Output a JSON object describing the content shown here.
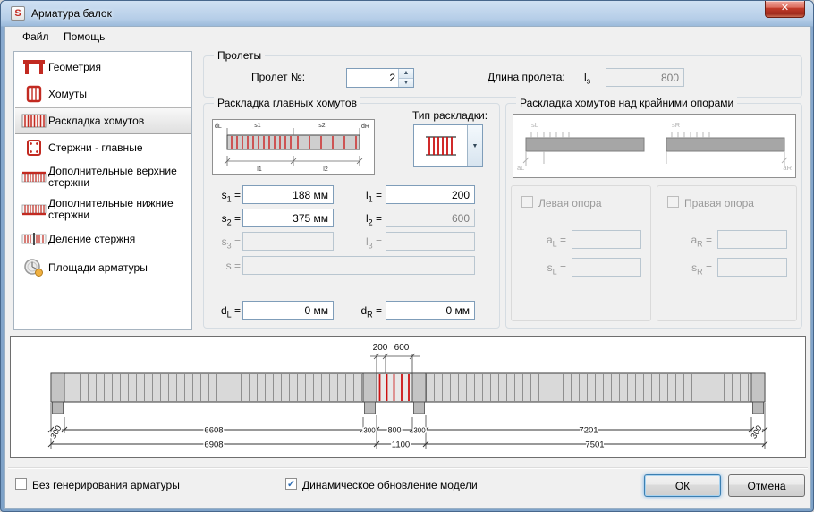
{
  "ui": {
    "equals": "=",
    "spin_up": "▲",
    "spin_down": "▼",
    "dropdown_arrow": "▼",
    "check_glyph": "✓"
  },
  "window": {
    "title": "Арматура балок",
    "app_initial": "S",
    "close_glyph": "✕"
  },
  "menu": {
    "items": [
      "Файл",
      "Помощь"
    ]
  },
  "sidebar": {
    "items": [
      "Геометрия",
      "Хомуты",
      "Раскладка хомутов",
      "Стержни - главные",
      "Дополнительные верхние стержни",
      "Дополнительные нижние стержни",
      "Деление стержня",
      "Площади арматуры"
    ]
  },
  "spans": {
    "title": "Пролеты",
    "span_no_label": "Пролет №:",
    "span_no_value": "2",
    "length_label": "Длина пролета:",
    "length_sym": "l",
    "length_sub": "s",
    "length_value": "800"
  },
  "layout_group": {
    "title": "Раскладка главных хомутов",
    "type_label": "Тип раскладки:",
    "mini_labels": {
      "dl": "dL",
      "s1": "s1",
      "s2": "s2",
      "dr": "dR",
      "l1": "l1",
      "l2": "l2"
    },
    "rows": [
      {
        "s_sym": "s",
        "s_sub": "1",
        "s_val": "188 мм",
        "l_sym": "l",
        "l_sub": "1",
        "l_val": "200"
      },
      {
        "s_sym": "s",
        "s_sub": "2",
        "s_val": "375 мм",
        "l_sym": "l",
        "l_sub": "2",
        "l_val": "600"
      },
      {
        "s_sym": "s",
        "s_sub": "3",
        "s_val": "",
        "l_sym": "l",
        "l_sub": "3",
        "l_val": ""
      }
    ],
    "s_row": {
      "sym": "s",
      "val": ""
    },
    "d_row": {
      "l_sym": "d",
      "l_sub": "L",
      "l_val": "0 мм",
      "r_sym": "d",
      "r_sub": "R",
      "r_val": "0 мм"
    }
  },
  "supports_group": {
    "title": "Раскладка хомутов над крайними опорами",
    "diagram_labels": {
      "sl": "sL",
      "sr": "sR",
      "al": "aL",
      "ar": "aR"
    },
    "left": {
      "check_label": "Левая опора",
      "a_sym": "a",
      "a_sub": "L",
      "a_val": "",
      "s_sym": "s",
      "s_sub": "L",
      "s_val": ""
    },
    "right": {
      "check_label": "Правая опора",
      "a_sym": "a",
      "a_sub": "R",
      "a_val": "",
      "s_sym": "s",
      "s_sub": "R",
      "s_val": ""
    }
  },
  "beam_diagram": {
    "top_dims": [
      "200",
      "600"
    ],
    "row1": [
      "300",
      "6608",
      "300",
      "800",
      "300",
      "7201",
      "300"
    ],
    "row2": [
      "6908",
      "1100",
      "7501"
    ]
  },
  "footer": {
    "no_generation_label": "Без генерирования арматуры",
    "dynamic_update_label": "Динамическое обновление модели",
    "ok_label": "ОК",
    "cancel_label": "Отмена"
  }
}
